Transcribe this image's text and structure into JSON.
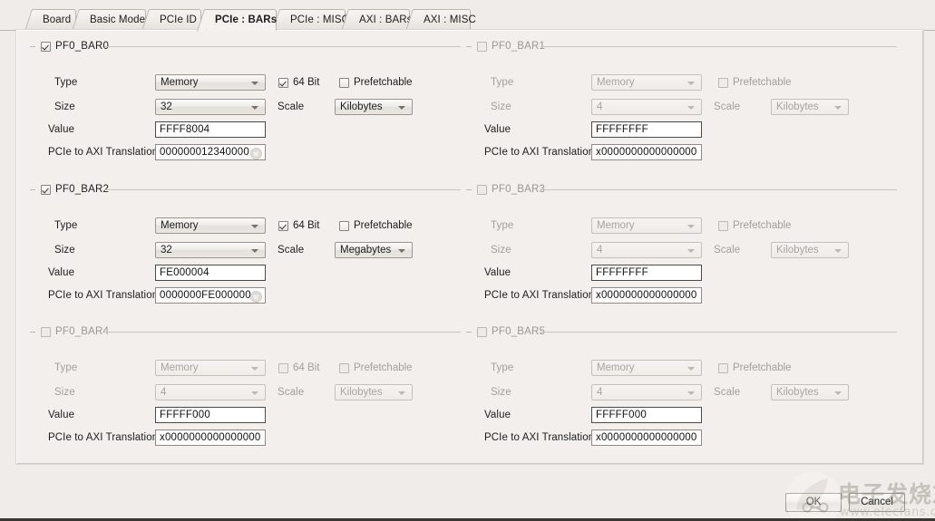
{
  "tabs": [
    {
      "label": "Board",
      "active": false
    },
    {
      "label": "Basic Mode",
      "active": false
    },
    {
      "label": "PCIe ID",
      "active": false
    },
    {
      "label": "PCIe : BARs",
      "active": true
    },
    {
      "label": "PCIe : MISC",
      "active": false
    },
    {
      "label": "AXI : BARs",
      "active": false
    },
    {
      "label": "AXI : MISC",
      "active": false
    }
  ],
  "labels": {
    "type": "Type",
    "size": "Size",
    "value": "Value",
    "translation": "PCIe to AXI Translation",
    "scale": "Scale",
    "sixtyfour_bit": "64 Bit",
    "prefetchable": "Prefetchable"
  },
  "bars": [
    {
      "name": "PF0_BAR0",
      "enabled": true,
      "type": "Memory",
      "size": "32",
      "scale": "Kilobytes",
      "value": "FFFF8004",
      "translation": "000000012340000",
      "has_64bit": true,
      "sixtyfour_bit_checked": true,
      "prefetchable_checked": false,
      "has_clear": true
    },
    {
      "name": "PF0_BAR1",
      "enabled": false,
      "type": "Memory",
      "size": "4",
      "scale": "Kilobytes",
      "value": "FFFFFFFF",
      "translation": "x0000000000000000",
      "has_64bit": false,
      "sixtyfour_bit_checked": false,
      "prefetchable_checked": false,
      "has_clear": false
    },
    {
      "name": "PF0_BAR2",
      "enabled": true,
      "type": "Memory",
      "size": "32",
      "scale": "Megabytes",
      "value": "FE000004",
      "translation": "0000000FE000000",
      "has_64bit": true,
      "sixtyfour_bit_checked": true,
      "prefetchable_checked": false,
      "has_clear": true
    },
    {
      "name": "PF0_BAR3",
      "enabled": false,
      "type": "Memory",
      "size": "4",
      "scale": "Kilobytes",
      "value": "FFFFFFFF",
      "translation": "x0000000000000000",
      "has_64bit": false,
      "sixtyfour_bit_checked": false,
      "prefetchable_checked": false,
      "has_clear": false
    },
    {
      "name": "PF0_BAR4",
      "enabled": false,
      "type": "Memory",
      "size": "4",
      "scale": "Kilobytes",
      "value": "FFFFF000",
      "translation": "x0000000000000000",
      "has_64bit": true,
      "sixtyfour_bit_checked": false,
      "prefetchable_checked": false,
      "has_clear": false
    },
    {
      "name": "PF0_BAR5",
      "enabled": false,
      "type": "Memory",
      "size": "4",
      "scale": "Kilobytes",
      "value": "FFFFF000",
      "translation": "x0000000000000000",
      "has_64bit": false,
      "sixtyfour_bit_checked": false,
      "prefetchable_checked": false,
      "has_clear": false
    }
  ],
  "buttons": {
    "ok": "OK",
    "cancel": "Cancel"
  },
  "watermark": {
    "chinese": "电子发烧友",
    "url": "www.elecfans.com"
  },
  "colors": {
    "background": "#efece9",
    "panel": "#f2efec",
    "text": "#1d1d1d",
    "disabled_text": "#a49f99",
    "border": "#9a958f"
  }
}
